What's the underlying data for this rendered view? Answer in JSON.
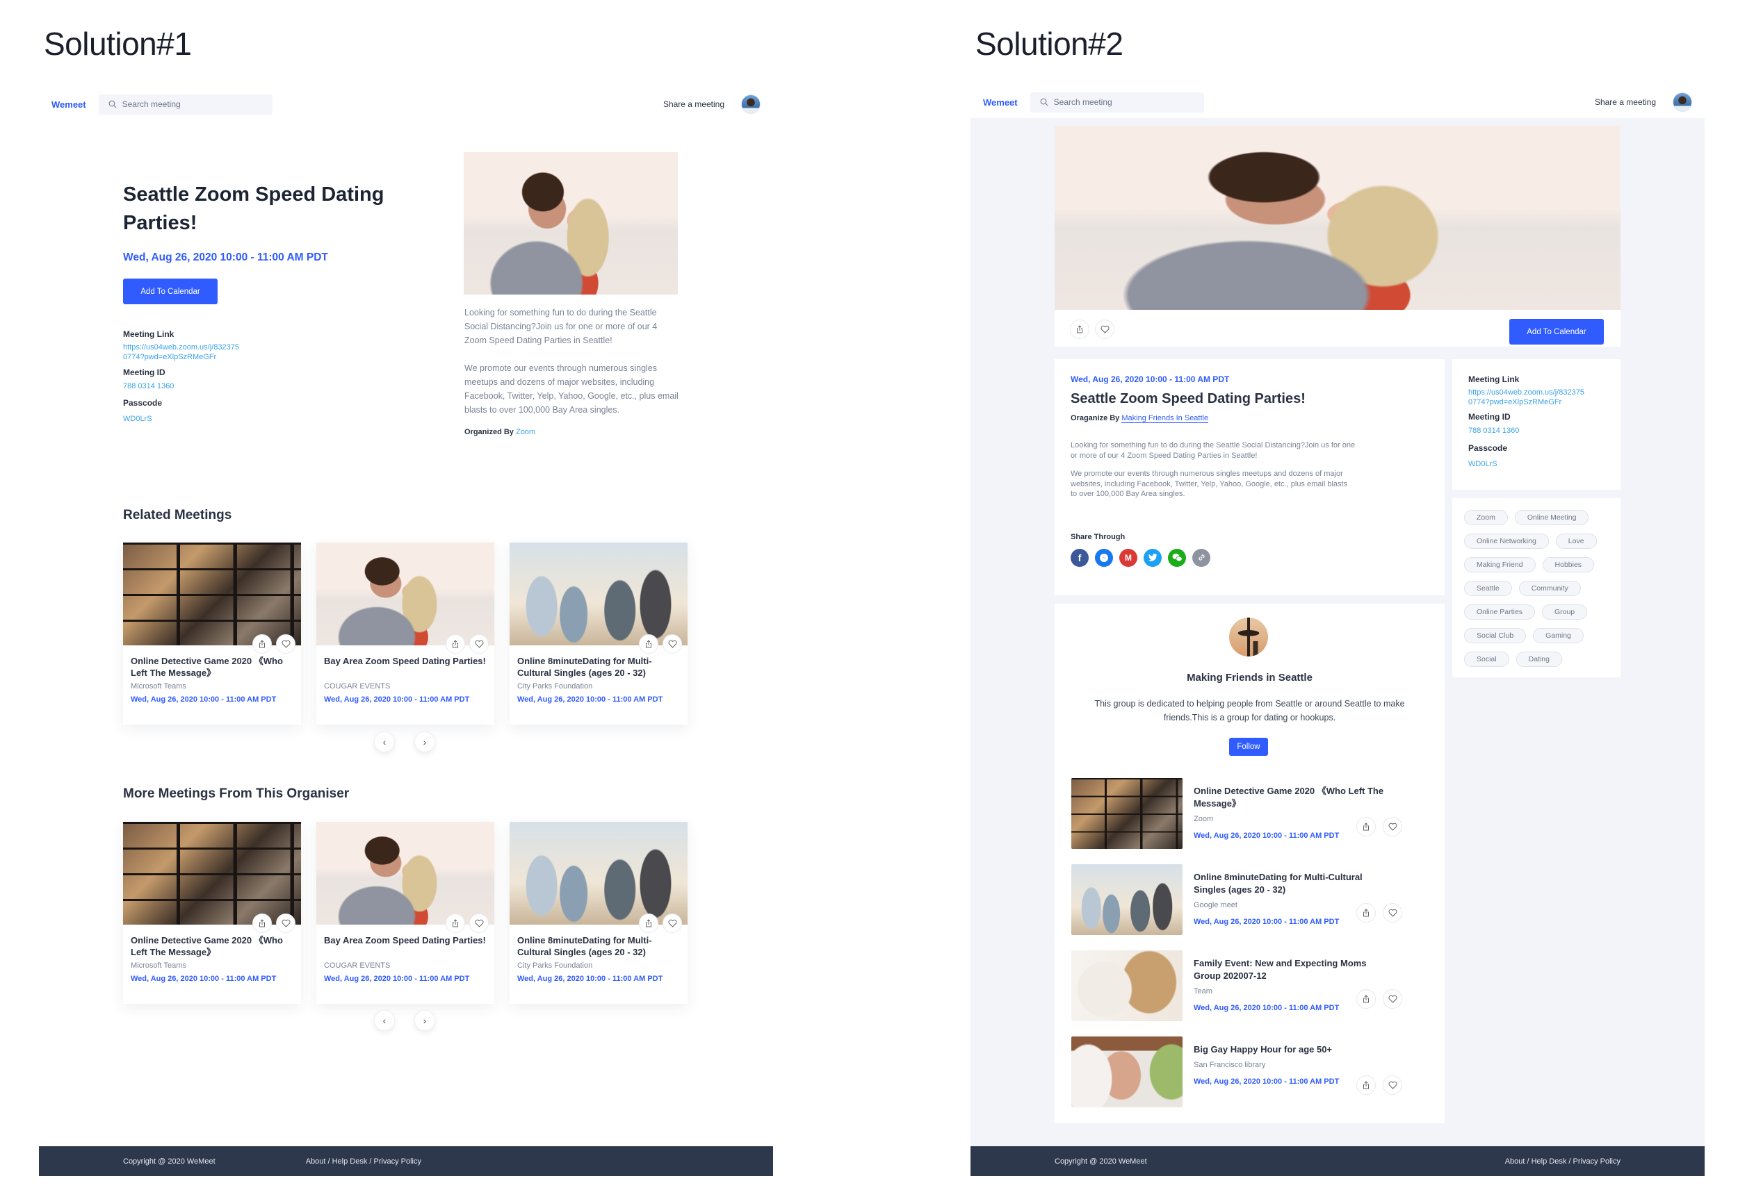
{
  "solutions": [
    {
      "title": "Solution#1"
    },
    {
      "title": "Solution#2"
    }
  ],
  "header": {
    "brand": "Wemeet",
    "search_placeholder": "Search meeting",
    "share_link": "Share a meeting"
  },
  "event": {
    "title": "Seattle Zoom Speed Dating Parties!",
    "date": "Wed, Aug 26, 2020 10:00 - 11:00 AM PDT",
    "add_to_calendar": "Add To Calendar",
    "meeting_link_label": "Meeting Link",
    "meeting_link": "https://us04web.zoom.us/j/8323750774?pwd=eXlpSzRMeGFr",
    "meeting_link_line1": "https://us04web.zoom.us/j/832375",
    "meeting_link_line2": "0774?pwd=eXlpSzRMeGFr",
    "meeting_id_label": "Meeting ID",
    "meeting_id": "788 0314 1360",
    "passcode_label": "Passcode",
    "passcode": "WD0LrS",
    "desc1": "Looking for something fun to do during the Seattle Social Distancing?Join us for one or more of our 4 Zoom Speed Dating Parties in Seattle!",
    "desc2": "We promote our events through numerous singles meetups and dozens of major websites, including Facebook, Twitter, Yelp, Yahoo, Google, etc., plus email blasts to over 100,000 Bay Area singles.",
    "organized_by_label": "Organized By",
    "organizer": "Zoom",
    "organize_by_label_2": "Oraganize By",
    "organizer_2": "Making Friends In Seattle"
  },
  "related": {
    "heading": "Related Meetings",
    "cards": [
      {
        "title": "Online Detective Game 2020 《Who Left The Message》",
        "org": "Microsoft Teams",
        "date": "Wed, Aug 26, 2020 10:00 - 11:00 AM PDT"
      },
      {
        "title": "Bay Area Zoom Speed Dating Parties!",
        "org": "COUGAR EVENTS",
        "date": "Wed, Aug 26, 2020 10:00 - 11:00 AM PDT"
      },
      {
        "title": "Online 8minuteDating for Multi-Cultural Singles (ages 20 - 32)",
        "org": "City Parks Foundation",
        "date": "Wed, Aug 26, 2020 10:00 - 11:00 AM PDT"
      }
    ]
  },
  "more": {
    "heading": "More Meetings From This Organiser",
    "cards": [
      {
        "title": "Online Detective Game 2020 《Who Left The Message》",
        "org": "Microsoft Teams",
        "date": "Wed, Aug 26, 2020 10:00 - 11:00 AM PDT"
      },
      {
        "title": "Bay Area Zoom Speed Dating Parties!",
        "org": "COUGAR EVENTS",
        "date": "Wed, Aug 26, 2020 10:00 - 11:00 AM PDT"
      },
      {
        "title": "Online 8minuteDating for Multi-Cultural Singles (ages 20 - 32)",
        "org": "City Parks Foundation",
        "date": "Wed, Aug 26, 2020 10:00 - 11:00 AM PDT"
      }
    ]
  },
  "pager": {
    "prev": "‹",
    "next": "›"
  },
  "share": {
    "label": "Share Through",
    "icons": [
      "facebook",
      "messenger",
      "gmail",
      "twitter",
      "wechat",
      "link"
    ]
  },
  "tags": [
    "Zoom",
    "Online Meeting",
    "Online Networking",
    "Love",
    "Making Friend",
    "Hobbies",
    "Seattle",
    "Community",
    "Online Parties",
    "Group",
    "Social Club",
    "Gaming",
    "Social",
    "Dating"
  ],
  "group": {
    "name": "Making Friends in Seattle",
    "desc": "This group is dedicated to helping people from Seattle or around Seattle to make friends.This is a group for dating or hookups.",
    "follow": "Follow"
  },
  "group_meetings": [
    {
      "title": "Online Detective Game 2020 《Who Left The Message》",
      "org": "Zoom",
      "date": "Wed, Aug 26, 2020 10:00 - 11:00 AM PDT"
    },
    {
      "title": "Online 8minuteDating for Multi-Cultural Singles (ages 20 - 32)",
      "org": "Google meet",
      "date": "Wed, Aug 26, 2020 10:00 - 11:00 AM PDT"
    },
    {
      "title": "Family Event: New and Expecting Moms Group 202007-12",
      "org": "Team",
      "date": "Wed, Aug 26, 2020 10:00 - 11:00 AM PDT"
    },
    {
      "title": "Big Gay Happy Hour for age 50+",
      "org": "San Francisco library",
      "date": "Wed, Aug 26, 2020 10:00 - 11:00 AM PDT"
    }
  ],
  "footer": {
    "copyright": "Copyright @ 2020 WeMeet",
    "links": "About / Help Desk / Privacy Policy"
  },
  "colors": {
    "accent": "#2f5bff",
    "link": "#3aa3ea",
    "footer": "#2e384d",
    "page_bg_2": "#f2f4fa"
  }
}
